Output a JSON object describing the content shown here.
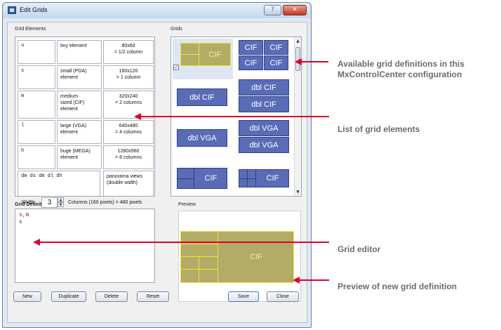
{
  "window": {
    "title": "Edit Grids",
    "help_glyph": "?",
    "close_glyph": "✕"
  },
  "grid_elements": {
    "label": "Grid Elements",
    "rows": [
      {
        "code": "u",
        "desc": "tiny element",
        "size": "80x60\n= 1/2 column"
      },
      {
        "code": "s",
        "desc": "small (PDA)\nelement",
        "size": "160x120\n= 1 column"
      },
      {
        "code": "m",
        "desc": "medium\nsized (CIF)\nelement",
        "size": "320x240\n= 2 columns"
      },
      {
        "code": "l",
        "desc": "large (VGA)\nelement",
        "size": "640x480\n= 4 columns"
      },
      {
        "code": "h",
        "desc": "huge (MEGA)\nelement",
        "size": "1280x960\n= 8 columns"
      },
      {
        "code": "dm ds dm dl dh",
        "desc": "",
        "size": "panorama\nviews (double\nwidth)"
      }
    ]
  },
  "grids": {
    "label": "Grids",
    "checked": "✓",
    "tiles": {
      "cif": "CIF",
      "dbl_cif": "dbl CIF",
      "dbl_vga": "dbl VGA"
    },
    "scroll_up": "▲",
    "scroll_down": "▼"
  },
  "definition": {
    "label": "Grid Definition",
    "width_label": "Width:",
    "width_value": "3",
    "columns_text": "Columns (160 pixels) = 480 pixels",
    "spin_up": "▲",
    "spin_down": "▼",
    "editor_lines": [
      "s,m",
      "s"
    ]
  },
  "preview": {
    "label": "Preview",
    "tile_label": "CIF"
  },
  "buttons": {
    "new": "New",
    "duplicate": "Duplicate",
    "delete": "Delete",
    "reset": "Reset",
    "save": "Save",
    "close": "Close"
  },
  "annotations": {
    "available": "Available grid definitions in this\nMxControlCenter configuration",
    "list": "List of grid elements",
    "editor": "Grid editor",
    "preview": "Preview of new grid definition"
  },
  "colors": {
    "annotation_arrow": "#e0002a",
    "grid_blue": "#5a6cb6",
    "grid_olive": "#b2ac66",
    "grid_yellow_line": "#f2e530"
  }
}
